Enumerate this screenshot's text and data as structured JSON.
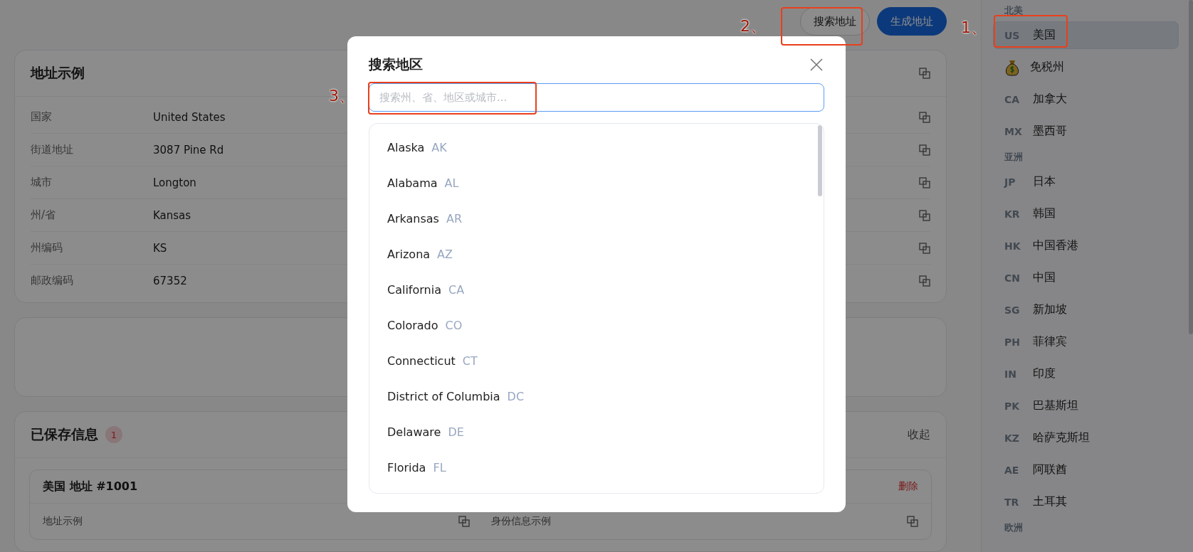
{
  "header_buttons": [
    {
      "label": "搜索地址",
      "kind": "outline"
    },
    {
      "label": "生成地址",
      "kind": "primary"
    }
  ],
  "address_card": {
    "title": "地址示例",
    "rows": [
      {
        "label": "国家",
        "value": "United States"
      },
      {
        "label": "街道地址",
        "value": "3087 Pine Rd"
      },
      {
        "label": "城市",
        "value": "Longton"
      },
      {
        "label": "州/省",
        "value": "Kansas"
      },
      {
        "label": "州编码",
        "value": "KS"
      },
      {
        "label": "邮政编码",
        "value": "67352"
      }
    ]
  },
  "saved": {
    "title": "已保存信息",
    "count": "1",
    "toggle": "收起",
    "entries": [
      {
        "title": "美国 地址 #1001",
        "delete": "删除",
        "sections": [
          "地址示例",
          "身份信息示例"
        ]
      }
    ]
  },
  "sidebar": {
    "groups": [
      {
        "name": "北美",
        "items": [
          {
            "kind": "code",
            "code": "US",
            "name": "美国",
            "selected": true
          },
          {
            "kind": "icon",
            "name": "免税州",
            "selected": false
          },
          {
            "kind": "code",
            "code": "CA",
            "name": "加拿大",
            "selected": false
          },
          {
            "kind": "code",
            "code": "MX",
            "name": "墨西哥",
            "selected": false
          }
        ]
      },
      {
        "name": "亚洲",
        "items": [
          {
            "kind": "code",
            "code": "JP",
            "name": "日本",
            "selected": false
          },
          {
            "kind": "code",
            "code": "KR",
            "name": "韩国",
            "selected": false
          },
          {
            "kind": "code",
            "code": "HK",
            "name": "中国香港",
            "selected": false
          },
          {
            "kind": "code",
            "code": "CN",
            "name": "中国",
            "selected": false
          },
          {
            "kind": "code",
            "code": "SG",
            "name": "新加坡",
            "selected": false
          },
          {
            "kind": "code",
            "code": "PH",
            "name": "菲律宾",
            "selected": false
          },
          {
            "kind": "code",
            "code": "IN",
            "name": "印度",
            "selected": false
          },
          {
            "kind": "code",
            "code": "PK",
            "name": "巴基斯坦",
            "selected": false
          },
          {
            "kind": "code",
            "code": "KZ",
            "name": "哈萨克斯坦",
            "selected": false
          },
          {
            "kind": "code",
            "code": "AE",
            "name": "阿联酋",
            "selected": false
          },
          {
            "kind": "code",
            "code": "TR",
            "name": "土耳其",
            "selected": false
          }
        ]
      },
      {
        "name": "欧洲"
      }
    ]
  },
  "dialog": {
    "title": "搜索地区",
    "search": {
      "placeholder": "搜索州、省、地区或城市..."
    },
    "regions": [
      {
        "name": "Alaska",
        "code": "AK"
      },
      {
        "name": "Alabama",
        "code": "AL"
      },
      {
        "name": "Arkansas",
        "code": "AR"
      },
      {
        "name": "Arizona",
        "code": "AZ"
      },
      {
        "name": "California",
        "code": "CA"
      },
      {
        "name": "Colorado",
        "code": "CO"
      },
      {
        "name": "Connecticut",
        "code": "CT"
      },
      {
        "name": "District of Columbia",
        "code": "DC"
      },
      {
        "name": "Delaware",
        "code": "DE"
      },
      {
        "name": "Florida",
        "code": "FL"
      }
    ]
  },
  "annotations": [
    {
      "label": "1、"
    },
    {
      "label": "2、"
    },
    {
      "label": "3、"
    }
  ]
}
